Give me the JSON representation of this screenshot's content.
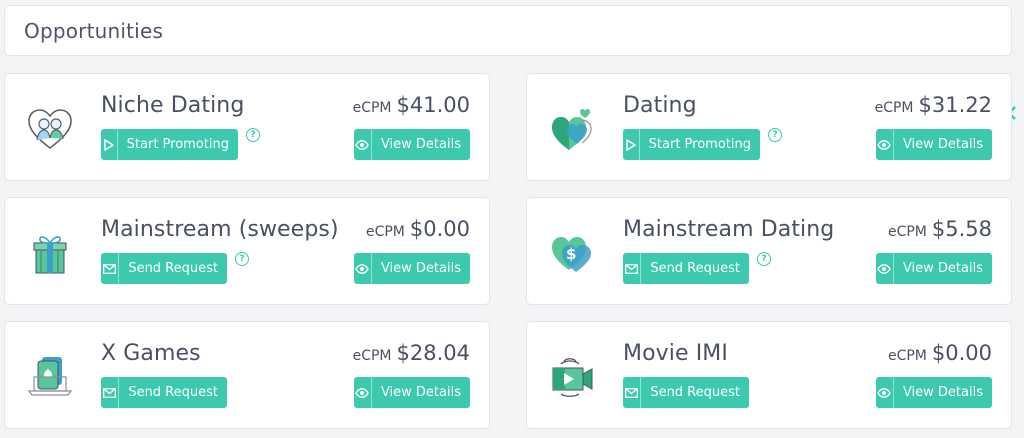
{
  "header": {
    "title": "Opportunities"
  },
  "buttons": {
    "start_promoting": "Start Promoting",
    "send_request": "Send Request",
    "view_details": "View Details",
    "help_glyph": "?"
  },
  "ecpm_label": "eCPM",
  "cards": [
    {
      "name": "Niche Dating",
      "ecpm": "$41.00",
      "action": "start_promoting",
      "icon": "couple-heart-icon",
      "help": true
    },
    {
      "name": "Dating",
      "ecpm": "$31.22",
      "action": "start_promoting",
      "icon": "green-hearts-icon",
      "help": true
    },
    {
      "name": "Mainstream (sweeps)",
      "ecpm": "$0.00",
      "action": "send_request",
      "icon": "gift-box-icon",
      "help": true
    },
    {
      "name": "Mainstream Dating",
      "ecpm": "$5.58",
      "action": "send_request",
      "icon": "dollar-heart-icon",
      "help": true
    },
    {
      "name": "X Games",
      "ecpm": "$28.04",
      "action": "send_request",
      "icon": "laptop-cards-icon",
      "help": false
    },
    {
      "name": "Movie IMI",
      "ecpm": "$0.00",
      "action": "send_request",
      "icon": "video-camera-icon",
      "help": false
    }
  ],
  "colors": {
    "accent": "#3cc9ae",
    "text": "#4a5062",
    "card_border": "#e2e4e8",
    "background": "#f3f4f6"
  }
}
